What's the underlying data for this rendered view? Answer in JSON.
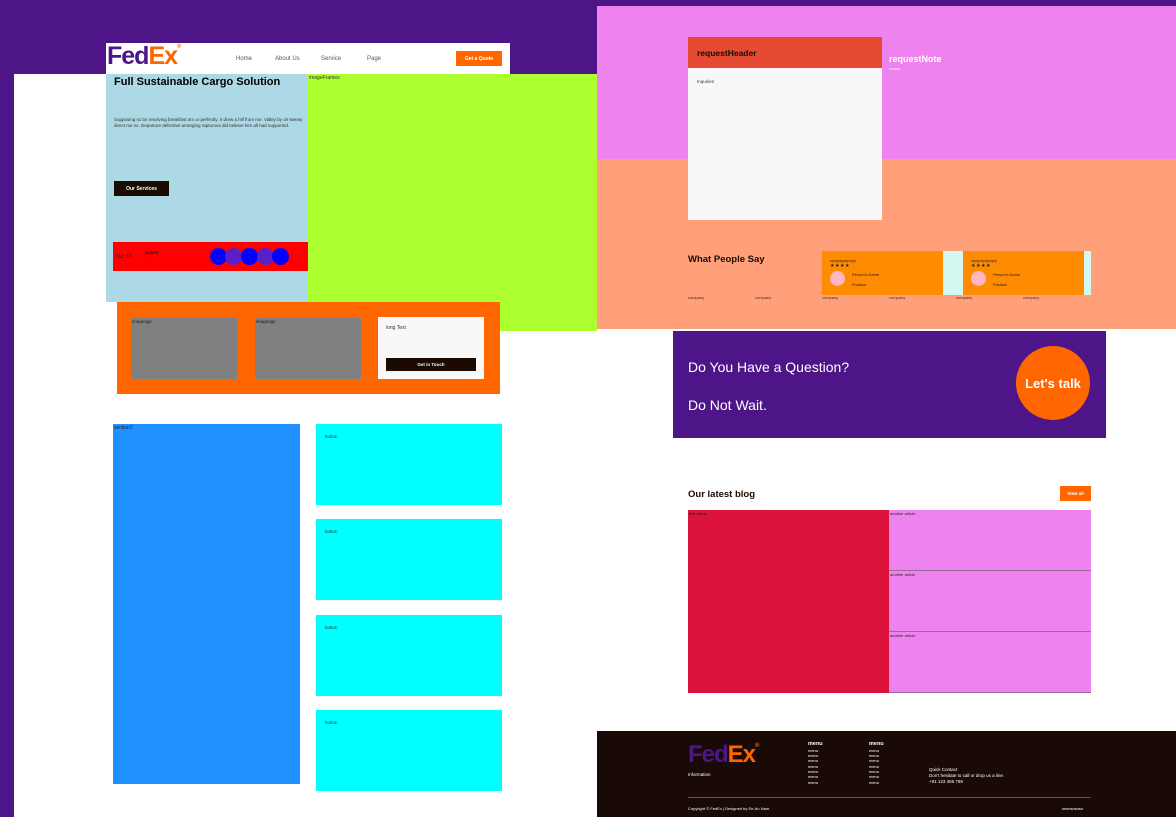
{
  "colors": {
    "backdrop": "#4e1589",
    "brand_purple": "#4d148c",
    "brand_orange": "#ff6600",
    "hero_bg": "#add8e6",
    "image_frame_bg": "#adff2f",
    "section_blue": "#1e90ff",
    "button_cyan": "#00ffff",
    "request_header": "#e44b32",
    "pink": "#ee82ee",
    "salmon": "#ffa07a",
    "blog_main": "#dc143c",
    "footer_bg": "#1a0a05"
  },
  "left": {
    "nav": {
      "logo_fed": "Fed",
      "logo_ex": "Ex",
      "logo_reg": "®",
      "links": [
        "Home",
        "About Us",
        "Service",
        "Page"
      ],
      "quote_button": "Get a Quote"
    },
    "hero": {
      "title": "Full Sustainable Cargo Solution",
      "description": "Supposing so be resolving breakfast am or perfectly. It drew a hill from me. Valley by oh twenty direct me so. Departure defective arranging rapturous did believe him all had supported.",
      "services_button": "Our Services",
      "strip_code": "Svc 12",
      "strip_title": "Safety",
      "strip_sub": "—"
    },
    "image_frame_label": "imageFrames",
    "promo": {
      "image_label_1": "imageage",
      "image_label_2": "imageage",
      "cta_text": "long Text",
      "cta_button": "Get in Touch"
    },
    "section_label": "section7",
    "buttons": [
      "button",
      "button",
      "button",
      "button"
    ]
  },
  "right": {
    "request": {
      "header": "requestHeader",
      "body": "Inquiries",
      "note": "requestNote",
      "note_sub": "contact"
    },
    "people": {
      "title": "What People Say",
      "cards": [
        {
          "head": "replyreplyreply",
          "stars": "★★★★",
          "name": "Person's Name",
          "position": "Position"
        },
        {
          "head": "replyreplyreply",
          "stars": "★★★★",
          "name": "Person's Name",
          "position": "Position"
        }
      ],
      "companies": [
        "company",
        "company",
        "company",
        "company",
        "company",
        "company"
      ]
    },
    "question": {
      "line1": "Do You Have a Question?",
      "line2": "Do Not Wait.",
      "talk_button": "Let's talk"
    },
    "blog": {
      "title": "Our latest blog",
      "view_all": "View all",
      "main_label": "first article",
      "side_labels": [
        "another article",
        "another article",
        "another article"
      ]
    },
    "footer": {
      "logo_fed": "Fed",
      "logo_ex": "Ex",
      "logo_reg": "®",
      "info": "Information",
      "menu_col1": {
        "head": "menu",
        "items": [
          "menu",
          "menu",
          "menu",
          "menu",
          "menu",
          "menu",
          "menu"
        ]
      },
      "menu_col2": {
        "head": "menu",
        "items": [
          "menu",
          "menu",
          "menu",
          "menu",
          "menu",
          "menu",
          "menu"
        ]
      },
      "quick_title": "Quick Contact",
      "quick_line": "Don't hesitate to call or drop us a line.",
      "quick_phone": "+91 123 456 789",
      "copyright": "Copyright © FedEx | Designed by Ee-An Nam",
      "right_text": "snsnsnsnsn"
    }
  }
}
